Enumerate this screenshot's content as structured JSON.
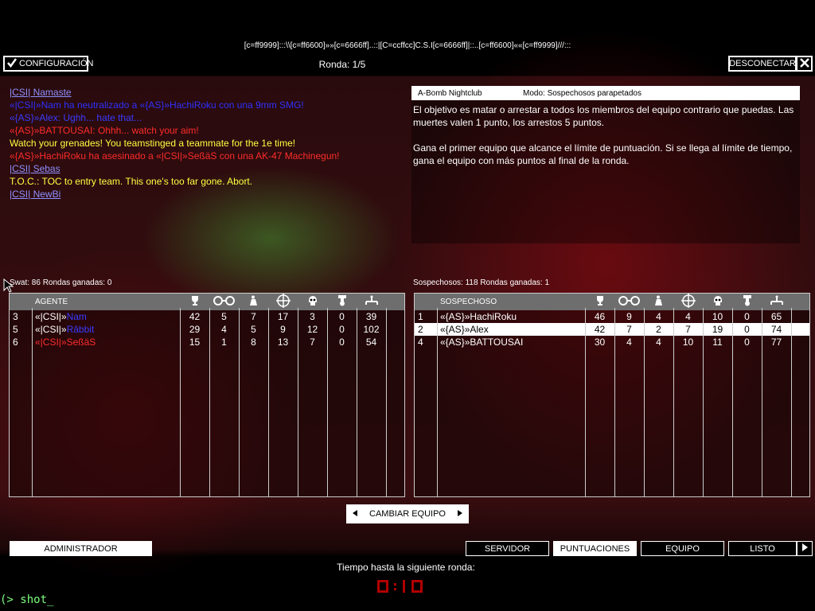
{
  "server_name": "[c=ff9999]:::\\\\[c=ff6600]»»[c=6666ff]..::|[C=ccffcc]C.S.I[c=6666ff]|::..[c=ff6600]««[c=ff9999]///:::",
  "config_button": "CONFIGURACIÓN",
  "round_label": "Ronda: 1/5",
  "disconnect_button": "DESCONECTAR",
  "chat": [
    {
      "text": " |CSI| Namaste",
      "color": "#8f8fff",
      "small": false
    },
    {
      "text": "«|CSI|»Nam ha neutralizado a «{AS}»HachiRoku con una 9mm SMG!",
      "color": "#3030ff",
      "small": false
    },
    {
      "text": "«{AS}»Alex: Ughh... hate that...",
      "color": "#3a3aff",
      "small": false
    },
    {
      "text": "«{AS}»BATTOUSAI: Ohhh... watch your aim!",
      "color": "#ff2b2b",
      "small": false
    },
    {
      "text": "Watch your grenades! You teamstinged a teammate for the 1e time!",
      "color": "#ffff40",
      "small": false
    },
    {
      "text": "«{AS}»HachiRoku ha asesinado a «|CSI|»SeßäS con una AK-47 Machinegun!",
      "color": "#ff2b2b",
      "small": false
    },
    {
      "text": " |CSI| Sebas",
      "color": "#8f8fff",
      "small": false
    },
    {
      "text": "T.O.C.: TOC to entry team.  This one's too far gone.  Abort.",
      "color": "#ffff40",
      "small": false
    },
    {
      "text": " |CSI| NewBi",
      "color": "#8f8fff",
      "small": false
    }
  ],
  "map_name": "A-Bomb Nightclub",
  "mode_label": "Modo: Sospechosos parapetados",
  "objective_text_1": "El objetivo es matar o arrestar a todos los miembros del equipo contrario que puedas. Las muertes valen 1 punto, los arrestos 5 puntos.",
  "objective_text_2": "Gana el primer equipo que alcance el límite de puntuación. Si se llega al límite de tiempo, gana el equipo con más puntos al final de la ronda.",
  "swat": {
    "label": "Swat: 86 Rondas ganadas: 0",
    "header": "AGENTE",
    "rows": [
      {
        "rank": "3",
        "name_prefix": "«|CSI|»",
        "name": "Nam",
        "name_color": "#3a3aff",
        "prefix_color": "#ffffff",
        "vals": [
          "42",
          "5",
          "7",
          "17",
          "3",
          "0",
          "39"
        ]
      },
      {
        "rank": "5",
        "name_prefix": "«|CSI|»",
        "name": "Râbbit",
        "name_color": "#3a3aff",
        "prefix_color": "#ffffff",
        "vals": [
          "29",
          "4",
          "5",
          "9",
          "12",
          "0",
          "102"
        ]
      },
      {
        "rank": "6",
        "name_prefix": "«|CSI|»",
        "name": "SeßäS",
        "name_color": "#ff2b2b",
        "prefix_color": "#ff2b2b",
        "vals": [
          "15",
          "1",
          "8",
          "13",
          "7",
          "0",
          "54"
        ]
      }
    ]
  },
  "suspects": {
    "label": "Sospechosos: 118 Rondas ganadas: 1",
    "header": "SOSPECHOSO",
    "rows": [
      {
        "rank": "1",
        "name": "«{AS}»HachiRoku",
        "selected": false,
        "vals": [
          "46",
          "9",
          "4",
          "4",
          "10",
          "0",
          "65"
        ]
      },
      {
        "rank": "2",
        "name": "«{AS}»Alex",
        "selected": true,
        "vals": [
          "42",
          "7",
          "2",
          "7",
          "19",
          "0",
          "74"
        ]
      },
      {
        "rank": "4",
        "name": "«{AS}»BATTOUSAI",
        "selected": false,
        "vals": [
          "30",
          "4",
          "4",
          "10",
          "11",
          "0",
          "77"
        ]
      }
    ]
  },
  "stat_icons": [
    "trophy-icon",
    "handcuffs-icon",
    "arrest-figure-icon",
    "crosshair-icon",
    "skull-icon",
    "medal-icon",
    "connection-icon"
  ],
  "change_team_button": "CAMBIAR EQUIPO",
  "admin_button": "ADMINISTRADOR",
  "bottom_buttons": [
    "SERVIDOR",
    "PUNTUACIONES",
    "EQUIPO",
    "LISTO"
  ],
  "next_round_label": "Tiempo hasta la siguiente ronda:",
  "console_prompt": "(> shot_",
  "colors": {
    "accent_red": "#cc0000",
    "grid_line": "#cccccc",
    "header_gray": "#6e6e6e"
  }
}
